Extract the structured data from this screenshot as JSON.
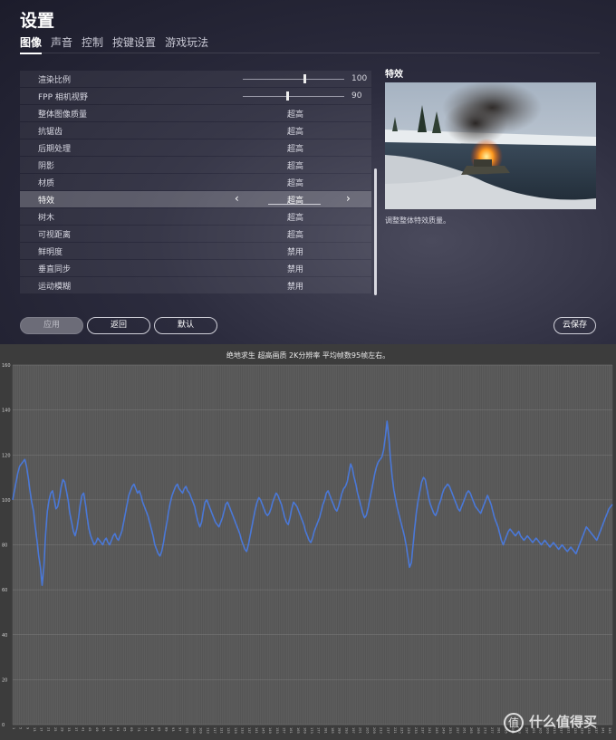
{
  "settings": {
    "title": "设置",
    "tabs": [
      {
        "label": "图像",
        "active": true
      },
      {
        "label": "声音",
        "active": false
      },
      {
        "label": "控制",
        "active": false
      },
      {
        "label": "按键设置",
        "active": false
      },
      {
        "label": "游戏玩法",
        "active": false
      }
    ],
    "rows": [
      {
        "label": "渲染比例",
        "kind": "slider",
        "value": "100",
        "fraction": 0.6
      },
      {
        "label": "FPP 相机视野",
        "kind": "slider",
        "value": "90",
        "fraction": 0.43
      },
      {
        "label": "整体图像质量",
        "value": "超高"
      },
      {
        "label": "抗锯齿",
        "value": "超高"
      },
      {
        "label": "后期处理",
        "value": "超高"
      },
      {
        "label": "阴影",
        "value": "超高"
      },
      {
        "label": "材质",
        "value": "超高"
      },
      {
        "label": "特效",
        "value": "超高",
        "selected": true
      },
      {
        "label": "树木",
        "value": "超高"
      },
      {
        "label": "可视距离",
        "value": "超高"
      },
      {
        "label": "鲜明度",
        "value": "禁用"
      },
      {
        "label": "垂直同步",
        "value": "禁用"
      },
      {
        "label": "运动模糊",
        "value": "禁用"
      }
    ],
    "detail": {
      "title": "特效",
      "description": "调整整体特效质量。"
    },
    "buttons": {
      "apply": "应用",
      "back": "返回",
      "default": "默认",
      "cloud_save": "云保存"
    },
    "icons": {
      "prev": "chevron-left-icon",
      "next": "chevron-right-icon"
    }
  },
  "watermark": {
    "text": "什么值得买",
    "icon": "值"
  },
  "chart_data": {
    "type": "line",
    "title": "绝地求生 超高画质 2K分辨率 平均帧数95帧左右。",
    "xlabel": "",
    "ylabel": "",
    "ylim": [
      0,
      160
    ],
    "yticks": [
      0,
      20,
      40,
      60,
      80,
      100,
      120,
      140,
      160
    ],
    "grid": true,
    "color": "#4a78d8",
    "series": [
      {
        "values": [
          100,
          104,
          108,
          112,
          115,
          116,
          117,
          118,
          115,
          110,
          104,
          99,
          95,
          88,
          82,
          75,
          70,
          62,
          70,
          85,
          95,
          100,
          103,
          104,
          100,
          96,
          97,
          101,
          106,
          109,
          108,
          104,
          100,
          94,
          90,
          86,
          84,
          87,
          92,
          98,
          102,
          103,
          98,
          92,
          87,
          84,
          82,
          80,
          81,
          83,
          82,
          81,
          80,
          82,
          83,
          81,
          80,
          82,
          84,
          85,
          83,
          82,
          84,
          86,
          90,
          94,
          98,
          102,
          104,
          106,
          107,
          105,
          103,
          104,
          102,
          99,
          97,
          95,
          93,
          90,
          87,
          84,
          80,
          78,
          76,
          75,
          77,
          81,
          86,
          90,
          95,
          99,
          102,
          104,
          106,
          107,
          105,
          104,
          103,
          105,
          106,
          104,
          103,
          101,
          99,
          97,
          93,
          90,
          88,
          90,
          95,
          99,
          100,
          98,
          96,
          94,
          92,
          90,
          89,
          88,
          90,
          92,
          95,
          98,
          99,
          97,
          95,
          93,
          91,
          89,
          87,
          85,
          82,
          80,
          78,
          77,
          80,
          84,
          88,
          92,
          96,
          99,
          101,
          100,
          98,
          96,
          94,
          93,
          94,
          96,
          99,
          101,
          103,
          102,
          100,
          98,
          95,
          92,
          90,
          89,
          92,
          96,
          99,
          98,
          97,
          95,
          93,
          91,
          89,
          86,
          84,
          82,
          81,
          83,
          86,
          88,
          90,
          92,
          95,
          98,
          100,
          103,
          104,
          102,
          100,
          98,
          96,
          95,
          97,
          100,
          103,
          105,
          106,
          108,
          112,
          116,
          114,
          110,
          107,
          103,
          100,
          97,
          94,
          92,
          93,
          96,
          100,
          104,
          108,
          112,
          115,
          117,
          118,
          119,
          122,
          128,
          135,
          128,
          118,
          110,
          104,
          100,
          96,
          93,
          90,
          87,
          84,
          80,
          75,
          70,
          72,
          80,
          88,
          95,
          100,
          104,
          108,
          110,
          109,
          105,
          101,
          98,
          96,
          94,
          93,
          95,
          98,
          100,
          103,
          105,
          106,
          107,
          106,
          104,
          102,
          100,
          98,
          96,
          95,
          97,
          99,
          101,
          103,
          104,
          103,
          101,
          99,
          97,
          96,
          95,
          94,
          96,
          98,
          100,
          102,
          100,
          98,
          95,
          92,
          90,
          88,
          85,
          82,
          80,
          82,
          84,
          86,
          87,
          86,
          85,
          84,
          85,
          86,
          84,
          83,
          82,
          83,
          84,
          83,
          82,
          81,
          82,
          83,
          82,
          81,
          80,
          81,
          82,
          81,
          80,
          79,
          80,
          81,
          80,
          79,
          78,
          79,
          80,
          79,
          78,
          77,
          78,
          79,
          78,
          77,
          76,
          78,
          80,
          82,
          84,
          86,
          88,
          87,
          86,
          85,
          84,
          83,
          82,
          84,
          86,
          88,
          90,
          92,
          94,
          96,
          97,
          98
        ]
      }
    ]
  }
}
